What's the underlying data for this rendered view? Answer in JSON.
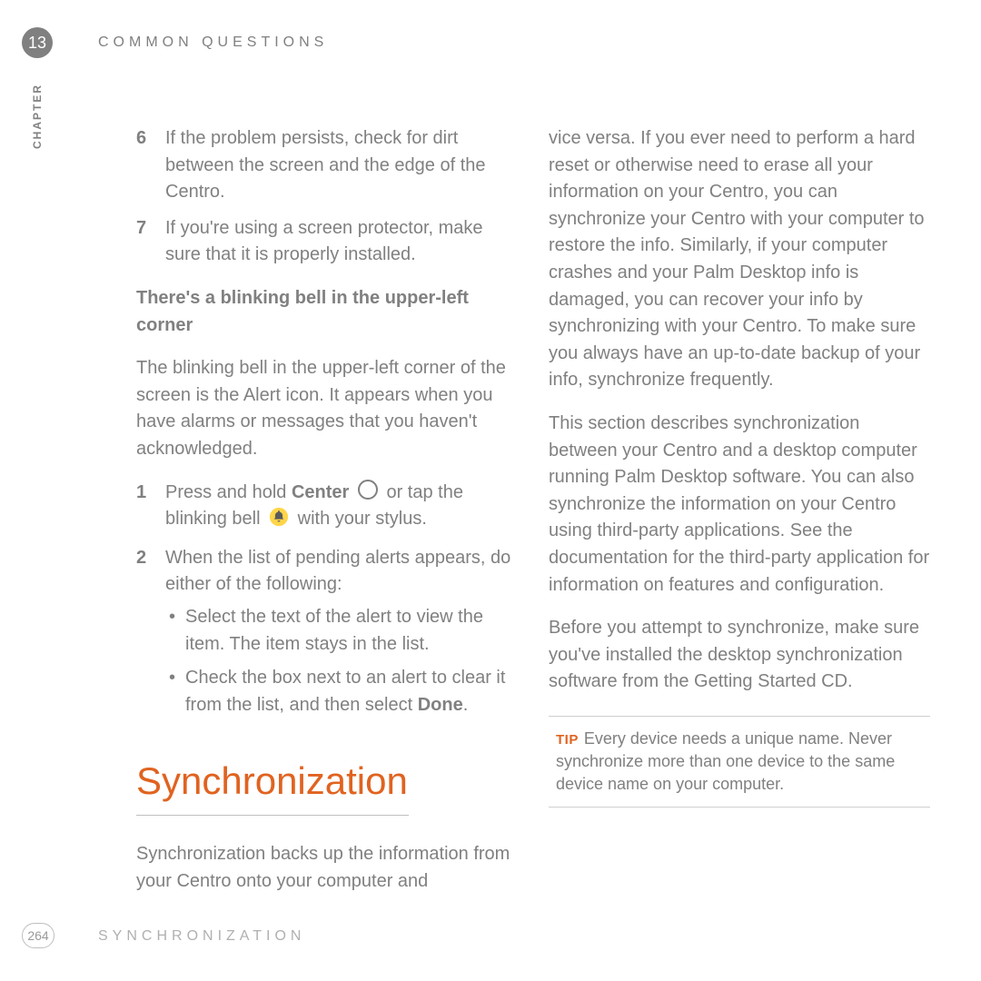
{
  "header": {
    "chapter_number": "13",
    "chapter_title": "COMMON QUESTIONS",
    "chapter_label_vertical": "CHAPTER"
  },
  "left_column": {
    "numbered_top": [
      {
        "n": "6",
        "text": "If the problem persists, check for dirt between the screen and the edge of the Centro."
      },
      {
        "n": "7",
        "text": "If you're using a screen protector, make sure that it is properly installed."
      }
    ],
    "subheading": "There's a blinking bell in the upper-left corner",
    "sub_para": "The blinking bell in the upper-left corner of the screen is the Alert icon. It appears when you have alarms or messages that you haven't acknowledged.",
    "step1_pre": "Press and hold ",
    "step1_center": "Center",
    "step1_mid": " or tap the blinking bell ",
    "step1_post": " with your stylus.",
    "step2_text": "When the list of pending alerts appears, do either of the following:",
    "bullets": [
      "Select the text of the alert to view the item. The item stays in the list.",
      {
        "pre": "Check the box next to an alert to clear it from the list, and then select ",
        "bold": "Done",
        "post": "."
      }
    ],
    "section_heading": "Synchronization",
    "section_intro": "Synchronization backs up the information from your Centro onto your computer and"
  },
  "right_column": {
    "para1": "vice versa. If you ever need to perform a hard reset or otherwise need to erase all your information on your Centro, you can synchronize your Centro with your computer to restore the info. Similarly, if your computer crashes and your Palm Desktop info is damaged, you can recover your info by synchronizing with your Centro. To make sure you always have an up-to-date backup of your info, synchronize frequently.",
    "para2": "This section describes synchronization between your Centro and a desktop computer running Palm Desktop software. You can also synchronize the information on your Centro using third-party applications. See the documentation for the third-party application for information on features and configuration.",
    "para3": "Before you attempt to synchronize, make sure you've installed the desktop synchronization software from the Getting Started CD.",
    "tip_label": "TIP",
    "tip_text": "Every device needs a unique name. Never synchronize more than one device to the same device name on your computer."
  },
  "footer": {
    "page_number": "264",
    "footer_title": "SYNCHRONIZATION"
  }
}
